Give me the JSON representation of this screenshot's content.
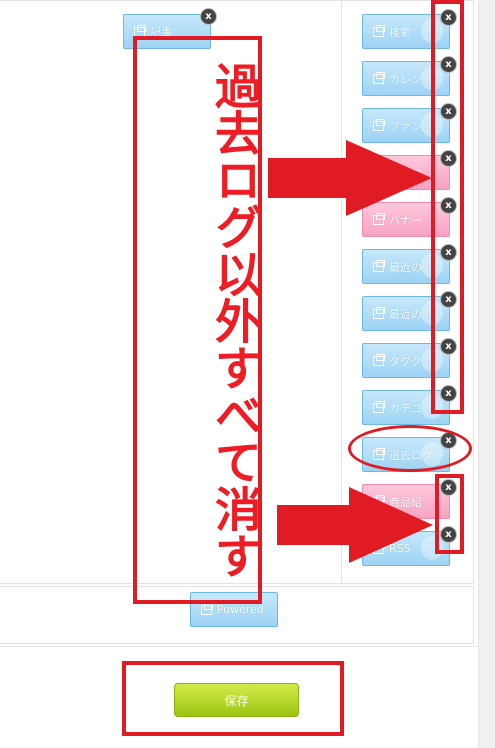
{
  "top_widget": {
    "label": "記事"
  },
  "right_widgets": [
    {
      "label": "検索",
      "color": "blue"
    },
    {
      "label": "カレン",
      "color": "blue"
    },
    {
      "label": "ファン",
      "color": "blue"
    },
    {
      "label": "プロフ",
      "color": "pink"
    },
    {
      "label": "バナー",
      "color": "pink"
    },
    {
      "label": "最近の",
      "color": "blue"
    },
    {
      "label": "最近の",
      "color": "blue"
    },
    {
      "label": "タグク",
      "color": "blue"
    },
    {
      "label": "カテゴ",
      "color": "blue"
    },
    {
      "label": "過去ログ",
      "color": "blue"
    },
    {
      "label": "商品紹",
      "color": "pink"
    },
    {
      "label": "RSS",
      "color": "blue"
    }
  ],
  "powered_widget": {
    "label": "Powered"
  },
  "close_symbol": "x",
  "annotation_text": "過去ログ以外すべて消す",
  "save_button": {
    "label": "保存"
  },
  "colors": {
    "annotation_red": "#e11b23",
    "widget_blue": "#9dd3f4",
    "widget_pink": "#f7a2c3",
    "save_green": "#9cc414"
  }
}
